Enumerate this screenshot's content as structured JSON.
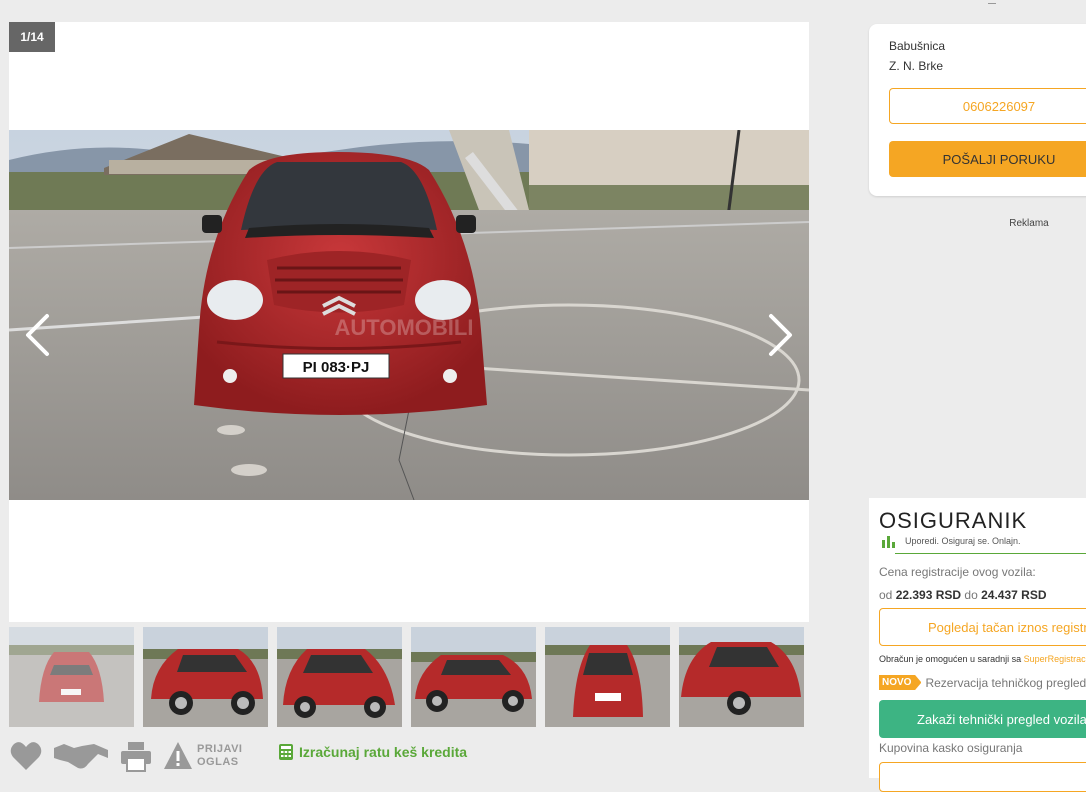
{
  "gallery": {
    "counter": "1/14",
    "watermark": "AUTOMOBILI",
    "plate": "PI 083·PJ"
  },
  "actions": {
    "report_label_line1": "PRIJAVI",
    "report_label_line2": "OGLAS",
    "credit_label": "Izračunaj ratu keš kredita"
  },
  "seller": {
    "city": "Babušnica",
    "street": "Z. N. Brke",
    "phone": "0606226097",
    "message_button": "POŠALJI PORUKU"
  },
  "ad_label": "Reklama",
  "insurance": {
    "brand": "OSIGURANIK",
    "tagline": "Uporedi. Osiguraj se. Onlajn.",
    "reg_label": "Cena registracije ovog vozila:",
    "price_from_word": "od",
    "price_from": "22.393 RSD",
    "price_to_word": "do",
    "price_to": "24.437 RSD",
    "view_button": "Pogledaj tačan iznos registracije",
    "partner_text": "Obračun je omogućen u saradnji sa",
    "partner_link": "SuperRegistracija",
    "new_badge": "NOVO",
    "inspection_text": "Rezervacija tehničkog pregleda",
    "schedule_button": "Zakaži tehnički pregled vozila",
    "kasko_label": "Kupovina kasko osiguranja"
  },
  "colors": {
    "accent_orange": "#f5a623",
    "accent_green": "#5aa839",
    "teal_button": "#3db483",
    "car_red": "#b52a2a"
  }
}
